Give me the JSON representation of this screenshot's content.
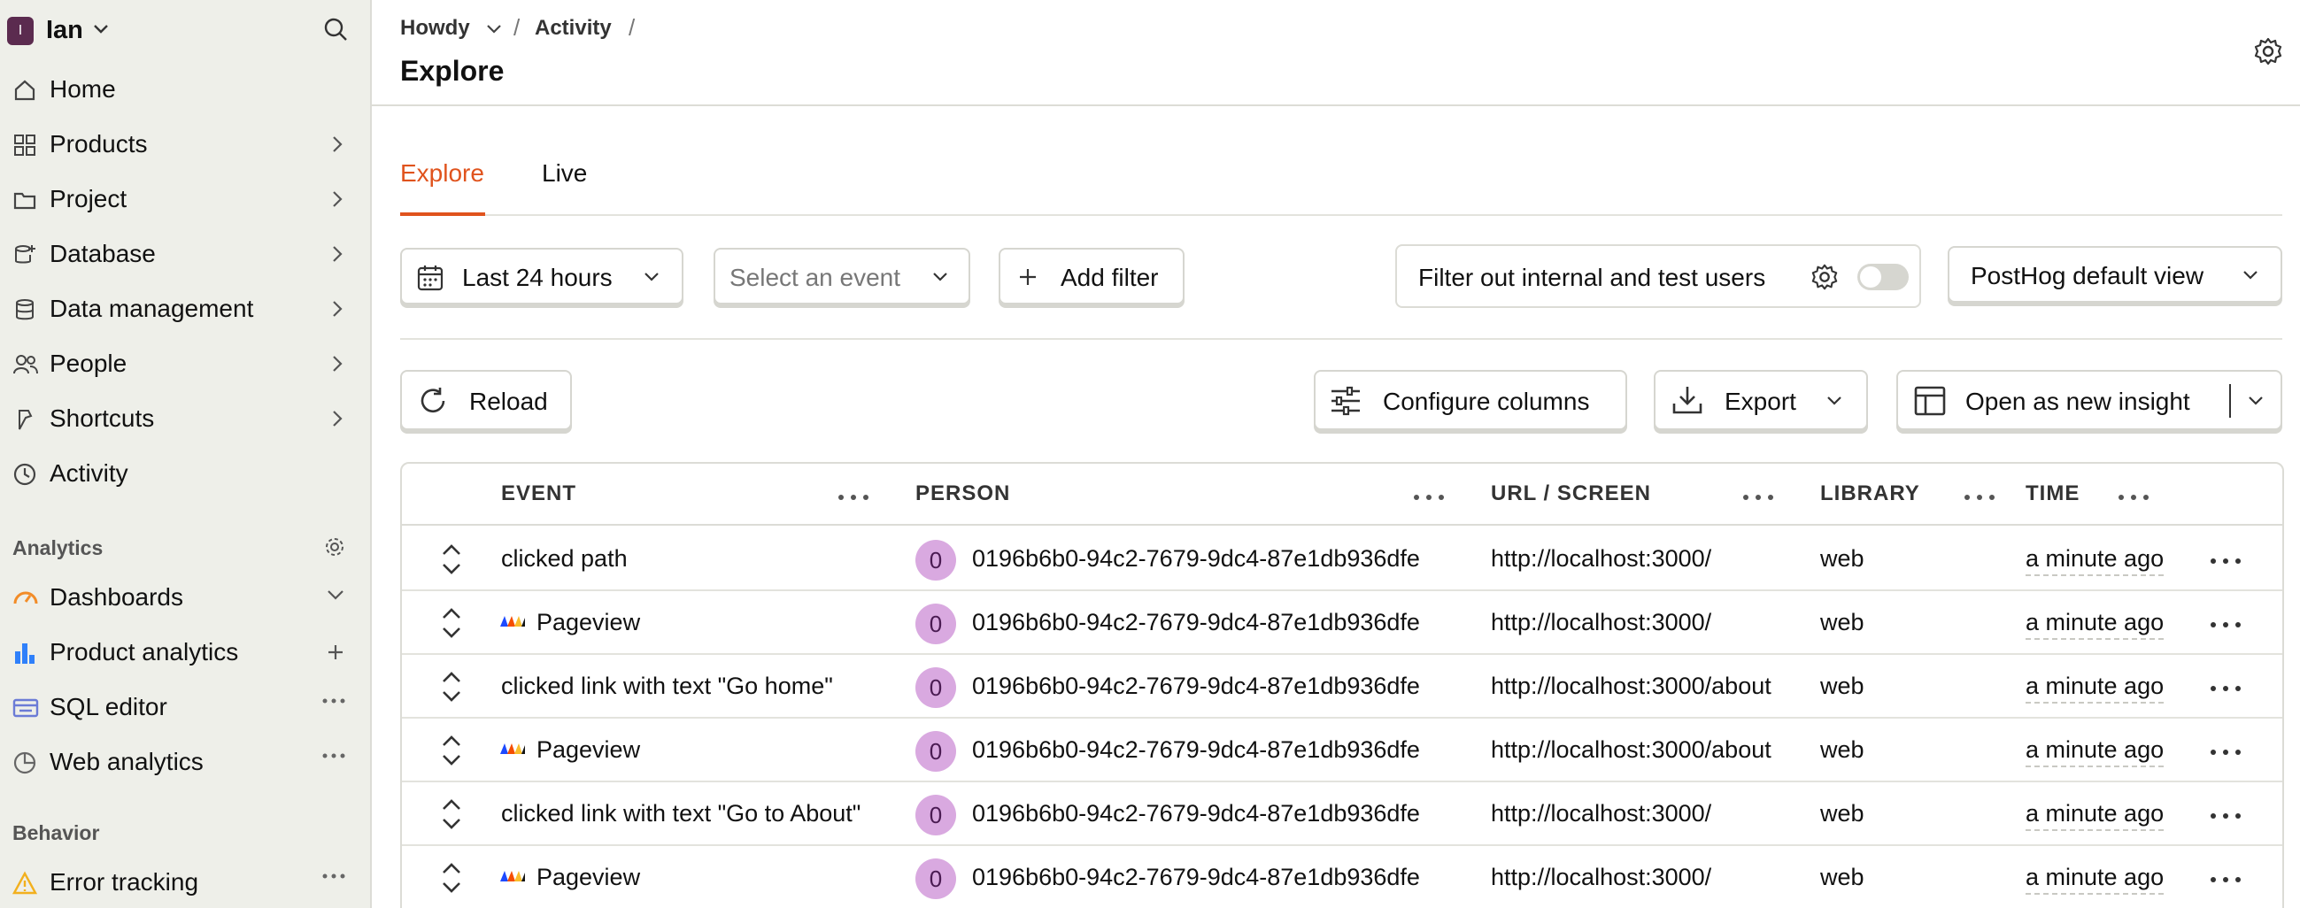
{
  "sidebar": {
    "org_initial": "I",
    "org_name": "Ian",
    "nav": [
      {
        "label": "Home"
      },
      {
        "label": "Products"
      },
      {
        "label": "Project"
      },
      {
        "label": "Database"
      },
      {
        "label": "Data management"
      },
      {
        "label": "People"
      },
      {
        "label": "Shortcuts"
      },
      {
        "label": "Activity"
      }
    ],
    "analytics_section": "Analytics",
    "analytics_items": [
      {
        "label": "Dashboards"
      },
      {
        "label": "Product analytics"
      },
      {
        "label": "SQL editor"
      },
      {
        "label": "Web analytics"
      }
    ],
    "behavior_section": "Behavior",
    "behavior_items": [
      {
        "label": "Error tracking"
      }
    ]
  },
  "header": {
    "breadcrumb": [
      "Howdy",
      "Activity"
    ],
    "separator": "/",
    "title": "Explore"
  },
  "tabs": [
    {
      "label": "Explore",
      "active": true
    },
    {
      "label": "Live",
      "active": false
    }
  ],
  "filters": {
    "date_range": "Last 24 hours",
    "event_placeholder": "Select an event",
    "add_filter": "Add filter",
    "internal_users": "Filter out internal and test users",
    "internal_toggle_on": false,
    "view": "PostHog default view"
  },
  "toolbar": {
    "reload": "Reload",
    "configure_columns": "Configure columns",
    "export": "Export",
    "open_insight": "Open as new insight"
  },
  "table": {
    "columns": [
      "EVENT",
      "PERSON",
      "URL / SCREEN",
      "LIBRARY",
      "TIME"
    ],
    "rows": [
      {
        "event": "clicked path",
        "pageview": false,
        "person_initial": "0",
        "person": "0196b6b0-94c2-7679-9dc4-87e1db936dfe",
        "url": "http://localhost:3000/",
        "library": "web",
        "time": "a minute ago"
      },
      {
        "event": "Pageview",
        "pageview": true,
        "person_initial": "0",
        "person": "0196b6b0-94c2-7679-9dc4-87e1db936dfe",
        "url": "http://localhost:3000/",
        "library": "web",
        "time": "a minute ago"
      },
      {
        "event": "clicked link with text \"Go home\"",
        "pageview": false,
        "person_initial": "0",
        "person": "0196b6b0-94c2-7679-9dc4-87e1db936dfe",
        "url": "http://localhost:3000/about",
        "library": "web",
        "time": "a minute ago"
      },
      {
        "event": "Pageview",
        "pageview": true,
        "person_initial": "0",
        "person": "0196b6b0-94c2-7679-9dc4-87e1db936dfe",
        "url": "http://localhost:3000/about",
        "library": "web",
        "time": "a minute ago"
      },
      {
        "event": "clicked link with text \"Go to About\"",
        "pageview": false,
        "person_initial": "0",
        "person": "0196b6b0-94c2-7679-9dc4-87e1db936dfe",
        "url": "http://localhost:3000/",
        "library": "web",
        "time": "a minute ago"
      },
      {
        "event": "Pageview",
        "pageview": true,
        "person_initial": "0",
        "person": "0196b6b0-94c2-7679-9dc4-87e1db936dfe",
        "url": "http://localhost:3000/",
        "library": "web",
        "time": "a minute ago"
      }
    ]
  },
  "colors": {
    "accent": "#e0531d",
    "sidebar_bg": "#eeefe9",
    "avatar_bg": "#d9a9e0",
    "product_analytics": "#2f80fa",
    "dashboards": "#f28c28",
    "sql_editor": "#6b7bd6",
    "error_tracking": "#f2b01e"
  }
}
